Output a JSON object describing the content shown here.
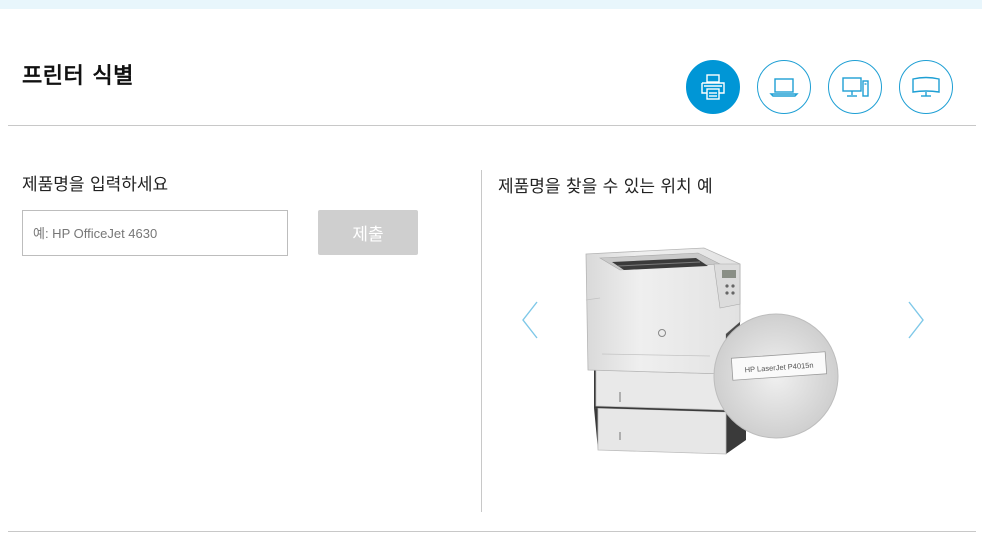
{
  "header": {
    "title": "프린터 식별"
  },
  "device_tabs": [
    {
      "name": "printer",
      "icon": "printer-icon",
      "active": true
    },
    {
      "name": "laptop",
      "icon": "laptop-icon",
      "active": false
    },
    {
      "name": "desktop",
      "icon": "desktop-icon",
      "active": false
    },
    {
      "name": "monitor",
      "icon": "monitor-icon",
      "active": false
    }
  ],
  "form": {
    "label": "제품명을 입력하세요",
    "input_value": "",
    "input_placeholder": "예: HP OfficeJet 4630",
    "submit_label": "제출"
  },
  "example": {
    "title": "제품명을 찾을 수 있는 위치 예",
    "product_label_text": "HP LaserJet P4015n"
  },
  "colors": {
    "accent": "#0096d6",
    "submit_disabled": "#cfcfcf",
    "top_strip": "#e8f6fc"
  }
}
